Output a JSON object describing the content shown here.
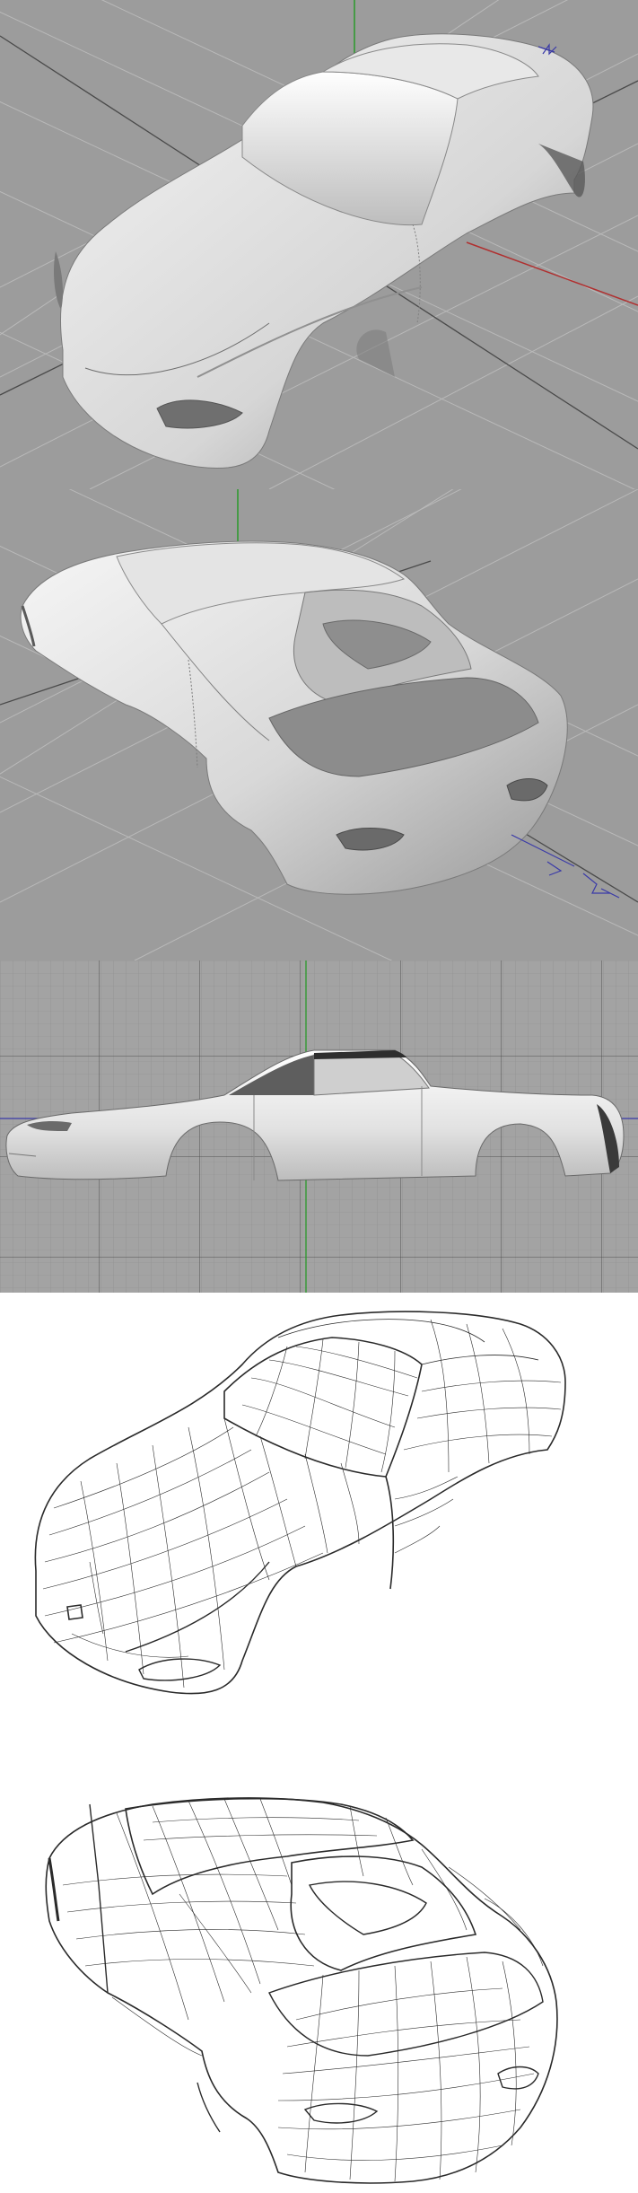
{
  "viewports": [
    {
      "id": "perspective-front-shaded",
      "axis_colors": {
        "x": "#b03030",
        "y": "#2a9a2a",
        "z": "#3a3aa8"
      },
      "background": "#9c9c9c"
    },
    {
      "id": "perspective-rear-shaded",
      "axis_colors": {
        "x": "#b03030",
        "y": "#2a9a2a",
        "z": "#3a3aa8"
      },
      "background": "#9c9c9c"
    },
    {
      "id": "side-orthographic-shaded",
      "axis_colors": {
        "x": "#3a3aa8",
        "y": "#2a9a2a"
      },
      "background": "#a3a3a3"
    },
    {
      "id": "perspective-front-wireframe",
      "background": "#ffffff"
    },
    {
      "id": "perspective-rear-wireframe",
      "background": "#ffffff"
    }
  ]
}
